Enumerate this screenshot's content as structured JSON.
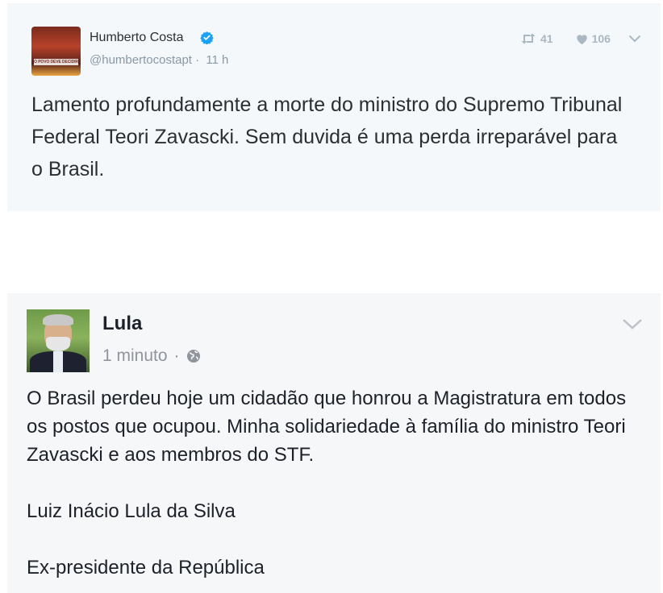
{
  "tweet": {
    "author_name": "Humberto Costa",
    "handle": "@humbertocostapt",
    "separator": "·",
    "time": "11 h",
    "retweet_count": "41",
    "like_count": "106",
    "text": "Lamento profundamente a morte do ministro do Supremo Tribunal Federal Teori Zavascki. Sem duvida é uma perda irreparável para o Brasil.",
    "avatar_banner": "O POVO DEVE DECIDIR",
    "icons": {
      "verified": "verified-badge-icon",
      "retweet": "retweet-icon",
      "like": "heart-icon",
      "menu": "chevron-down-icon"
    },
    "colors": {
      "verified": "#1da1f2",
      "background": "#f5f8fa",
      "muted": "#8899a6"
    }
  },
  "facebook_post": {
    "author_name": "Lula",
    "time": "1 minuto",
    "separator": "·",
    "paragraphs": [
      "O Brasil perdeu hoje um cidadão que honrou a Magistratura em todos os postos que ocupou. Minha solidariedade à família do ministro Teori Zavascki e aos membros do STF.",
      "Luiz Inácio Lula da Silva",
      "Ex-presidente da República"
    ],
    "icons": {
      "privacy": "globe-icon",
      "menu": "chevron-down-icon"
    },
    "colors": {
      "background": "#f6f7f9",
      "muted": "#90949c"
    }
  }
}
